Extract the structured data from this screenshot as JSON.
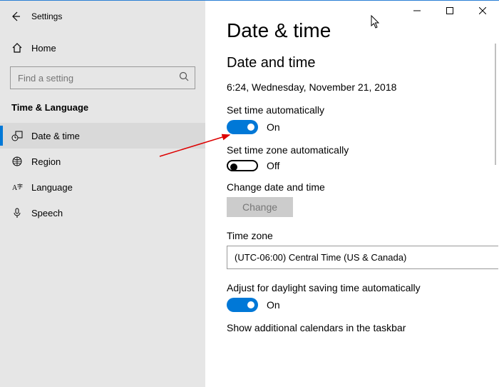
{
  "window": {
    "title": "Settings"
  },
  "sidebar": {
    "home_label": "Home",
    "search_placeholder": "Find a setting",
    "category": "Time & Language",
    "items": [
      {
        "label": "Date & time",
        "selected": true
      },
      {
        "label": "Region",
        "selected": false
      },
      {
        "label": "Language",
        "selected": false
      },
      {
        "label": "Speech",
        "selected": false
      }
    ]
  },
  "main": {
    "heading": "Date & time",
    "section_heading": "Date and time",
    "current_datetime": "6:24, Wednesday, November 21, 2018",
    "set_time_auto": {
      "label": "Set time automatically",
      "state": "On"
    },
    "set_tz_auto": {
      "label": "Set time zone automatically",
      "state": "Off"
    },
    "change_label": "Change date and time",
    "change_button": "Change",
    "timezone_label": "Time zone",
    "timezone_value": "(UTC-06:00) Central Time (US & Canada)",
    "dst": {
      "label": "Adjust for daylight saving time automatically",
      "state": "On"
    },
    "additional_cal_label": "Show additional calendars in the taskbar"
  }
}
